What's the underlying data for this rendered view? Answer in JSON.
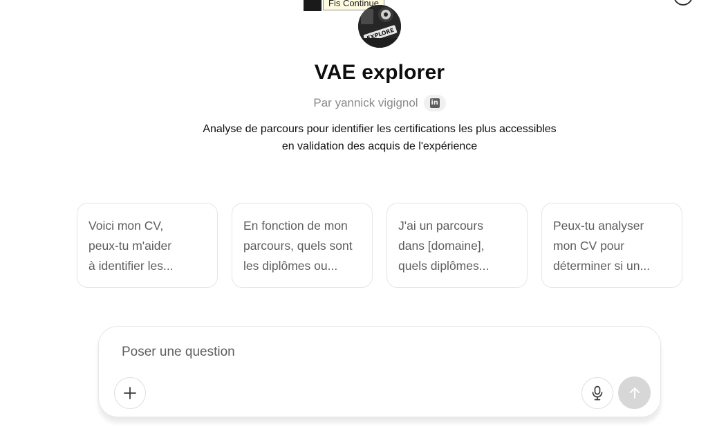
{
  "tooltip": {
    "text": "Fis Continue"
  },
  "gpt": {
    "name": "VAE explorer",
    "byline": "Par yannick vigignol",
    "linkedin_badge": "in",
    "description_line1": "Analyse de parcours pour identifier les certifications les plus accessibles",
    "description_line2": "en validation des acquis de l'expérience",
    "avatar_text": "EXPLORE"
  },
  "suggestions": [
    {
      "line1": "Voici mon CV,",
      "line2": "peux-tu m'aider",
      "line3": "à identifier les..."
    },
    {
      "line1": "En fonction de mon",
      "line2": "parcours, quels sont",
      "line3": "les diplômes ou..."
    },
    {
      "line1": "J'ai un parcours",
      "line2": "dans [domaine],",
      "line3": "quels diplômes..."
    },
    {
      "line1": "Peux-tu analyser",
      "line2": "mon CV pour",
      "line3": "déterminer si un..."
    }
  ],
  "composer": {
    "placeholder": "Poser une question",
    "icons": {
      "attach": "plus-icon",
      "voice": "microphone-icon",
      "send": "arrow-up-icon"
    }
  },
  "colors": {
    "text_primary": "#0d0d0d",
    "text_secondary": "#5d5d5d",
    "text_muted": "#8a8a8a",
    "send_disabled": "#d7d7d7",
    "border": "#e5e5e5"
  }
}
